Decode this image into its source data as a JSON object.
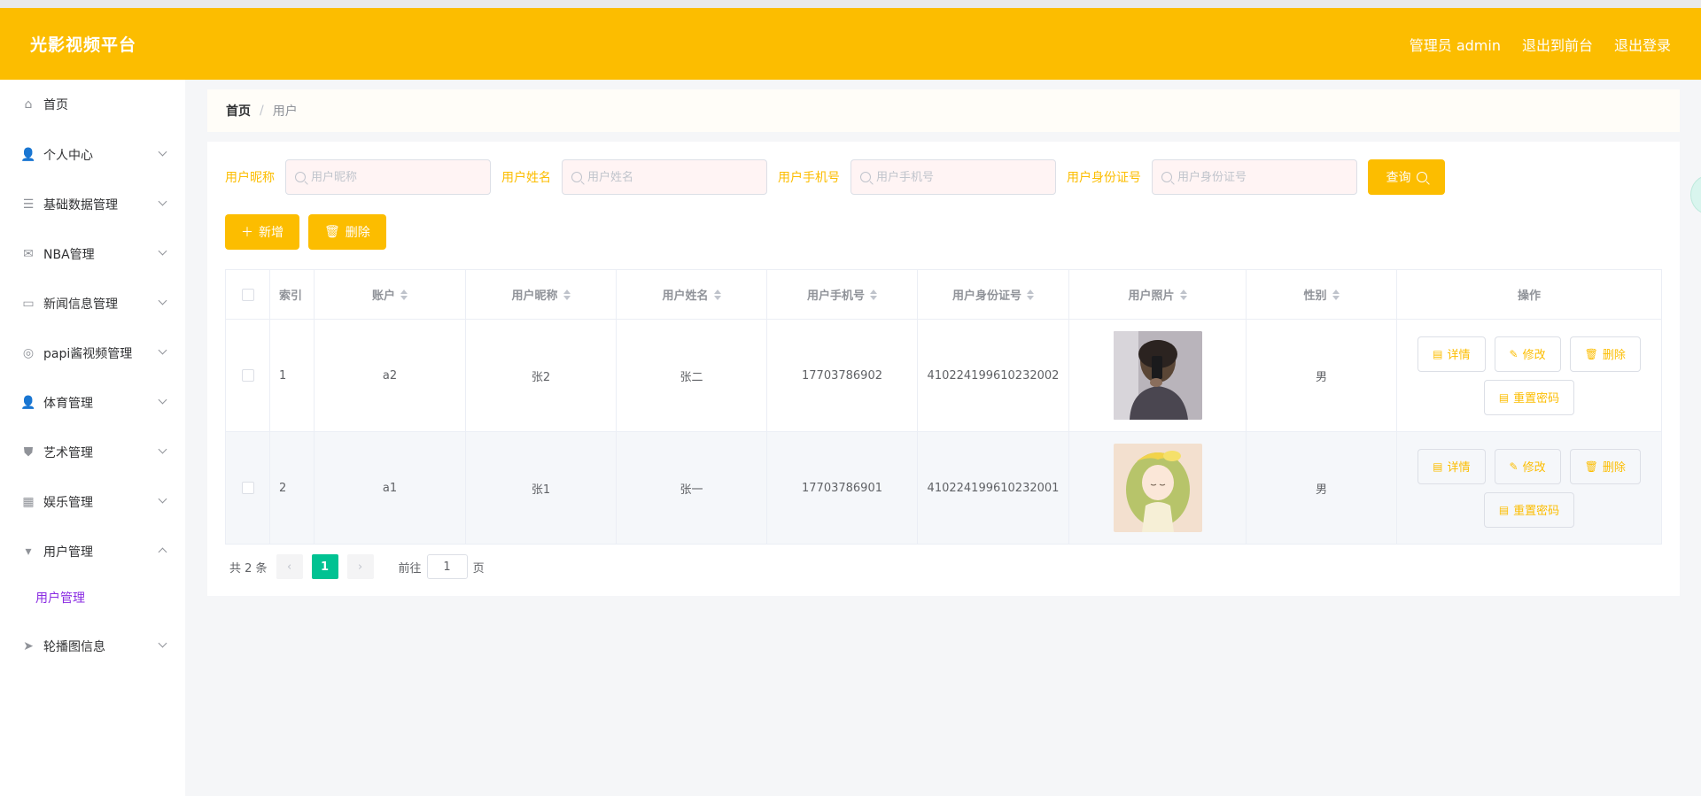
{
  "header": {
    "brand": "光影视频平台",
    "admin": "管理员 admin",
    "front": "退出到前台",
    "logout": "退出登录"
  },
  "sidebar": {
    "items": [
      {
        "label": "首页",
        "icon": "home-icon",
        "glyph": "⌂",
        "chevron": "none"
      },
      {
        "label": "个人中心",
        "icon": "user-icon",
        "glyph": "👤",
        "chevron": "down"
      },
      {
        "label": "基础数据管理",
        "icon": "list-icon",
        "glyph": "☰",
        "chevron": "down"
      },
      {
        "label": "NBA管理",
        "icon": "mail-icon",
        "glyph": "✉",
        "chevron": "down"
      },
      {
        "label": "新闻信息管理",
        "icon": "news-icon",
        "glyph": "▭",
        "chevron": "down"
      },
      {
        "label": "papi酱视频管理",
        "icon": "help-icon",
        "glyph": "◎",
        "chevron": "down"
      },
      {
        "label": "体育管理",
        "icon": "user-icon",
        "glyph": "👤",
        "chevron": "down"
      },
      {
        "label": "艺术管理",
        "icon": "stamp-icon",
        "glyph": "⛊",
        "chevron": "down"
      },
      {
        "label": "娱乐管理",
        "icon": "grid-icon",
        "glyph": "▦",
        "chevron": "down"
      },
      {
        "label": "用户管理",
        "icon": "brush-icon",
        "glyph": "▾",
        "chevron": "up"
      },
      {
        "label": "轮播图信息",
        "icon": "send-icon",
        "glyph": "➤",
        "chevron": "down"
      }
    ],
    "submenu": {
      "label": "用户管理"
    }
  },
  "breadcrumb": {
    "home": "首页",
    "sep": "/",
    "current": "用户"
  },
  "search": {
    "fields": [
      {
        "label": "用户昵称",
        "placeholder": "用户昵称"
      },
      {
        "label": "用户姓名",
        "placeholder": "用户姓名"
      },
      {
        "label": "用户手机号",
        "placeholder": "用户手机号"
      },
      {
        "label": "用户身份证号",
        "placeholder": "用户身份证号"
      }
    ],
    "query_label": "查询"
  },
  "actions": {
    "add_label": "新增",
    "delete_label": "删除"
  },
  "table": {
    "headers": {
      "index": "索引",
      "account": "账户",
      "nickname": "用户昵称",
      "name": "用户姓名",
      "phone": "用户手机号",
      "idcard": "用户身份证号",
      "photo": "用户照片",
      "gender": "性别",
      "ops": "操作"
    },
    "rows": [
      {
        "index": "1",
        "account": "a2",
        "nickname": "张2",
        "name": "张二",
        "phone": "17703786902",
        "idcard": "410224199610232002",
        "gender": "男"
      },
      {
        "index": "2",
        "account": "a1",
        "nickname": "张1",
        "name": "张一",
        "phone": "17703786901",
        "idcard": "410224199610232001",
        "gender": "男"
      }
    ],
    "op_labels": {
      "detail": "详情",
      "edit": "修改",
      "delete": "删除",
      "reset": "重置密码"
    }
  },
  "pagination": {
    "total": "共 2 条",
    "current": "1",
    "goto_prefix": "前往",
    "goto_value": "1",
    "goto_suffix": "页"
  },
  "colors": {
    "accent": "#fcbd00",
    "page_active": "#00c292",
    "submenu_active": "#8a2be2"
  }
}
